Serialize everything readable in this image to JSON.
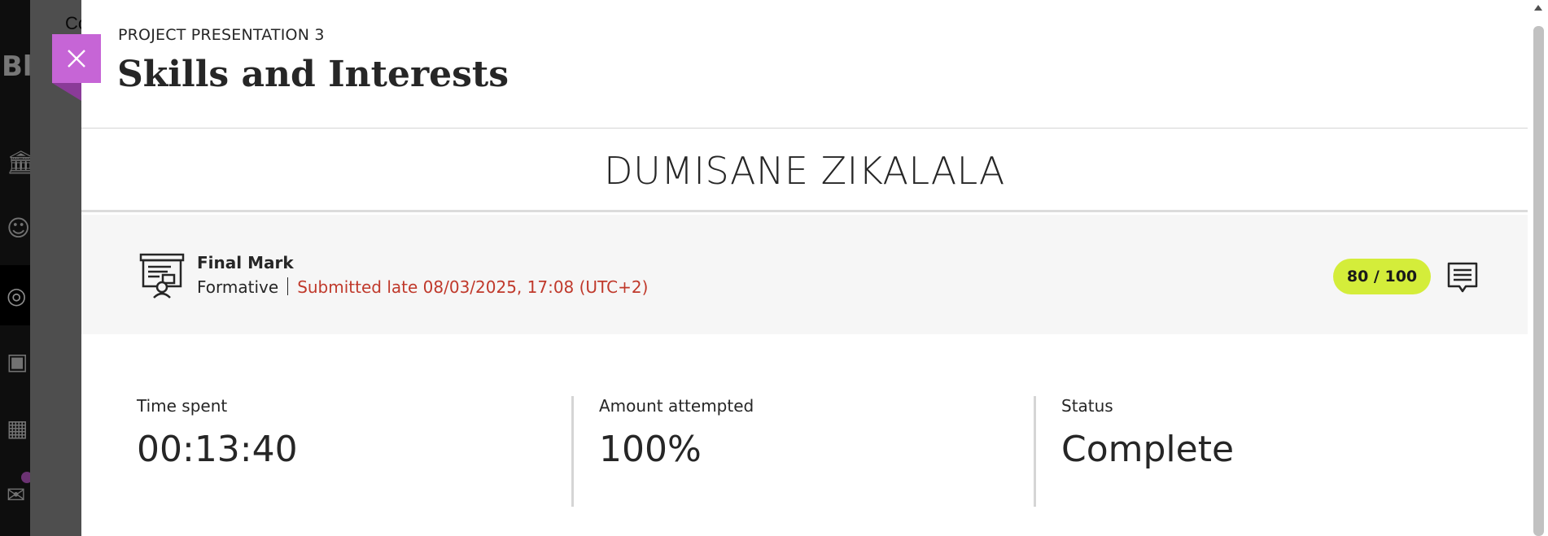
{
  "background": {
    "logo_text": "Bl",
    "header_text": "Co"
  },
  "panel": {
    "close_label": "Close",
    "kicker": "PROJECT PRESENTATION 3",
    "title": "Skills and Interests",
    "student_name": "DUMISANE ZIKALALA"
  },
  "grade": {
    "title": "Final Mark",
    "category": "Formative",
    "submission_status": "Submitted late 08/03/2025, 17:08 (UTC+2)",
    "score": "80 / 100"
  },
  "stats": [
    {
      "label": "Time spent",
      "value": "00:13:40"
    },
    {
      "label": "Amount attempted",
      "value": "100%"
    },
    {
      "label": "Status",
      "value": "Complete"
    }
  ],
  "colors": {
    "accent": "#c665d6",
    "late": "#c0392b",
    "score_pill": "#d4ed3a"
  }
}
